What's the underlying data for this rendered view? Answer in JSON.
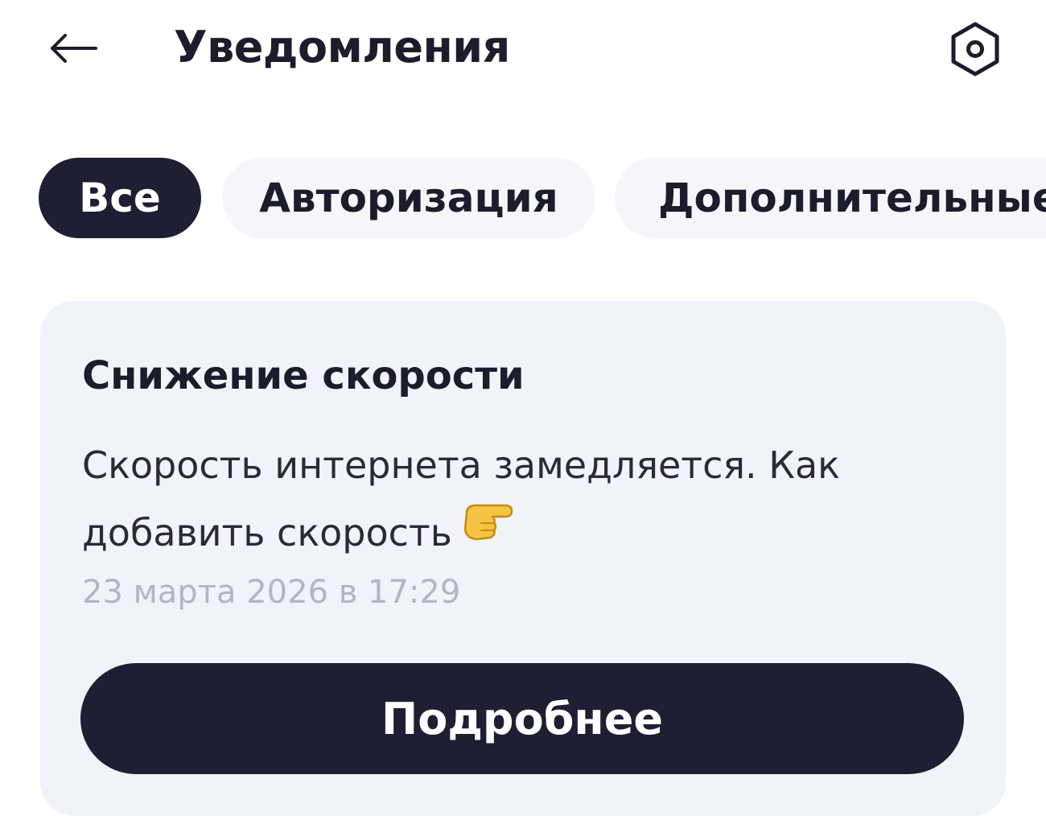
{
  "header": {
    "title": "Уведомления",
    "back_icon": "arrow-left-icon",
    "settings_icon": "hex-settings-icon"
  },
  "tabs": [
    {
      "label": "Все",
      "active": true
    },
    {
      "label": "Авторизация",
      "active": false
    },
    {
      "label": "Дополнительные",
      "active": false
    }
  ],
  "notification": {
    "title": "Снижение скорости",
    "body": "Скорость интернета замедляется. Как добавить скорость",
    "emoji_icon": "pointing-right-hand-icon",
    "date": "23 марта 2026 в 17:29",
    "button_label": "Подробнее"
  },
  "colors": {
    "dark": "#1e1f33",
    "card_bg": "#f0f4f8",
    "muted_text": "#b3b6bf"
  }
}
